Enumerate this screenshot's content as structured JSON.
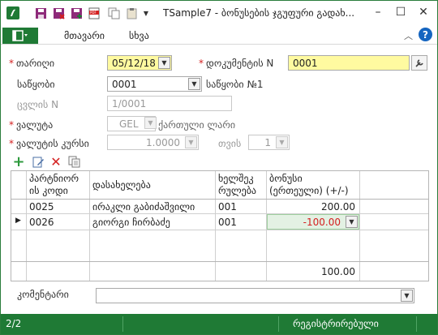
{
  "titlebar": {
    "title": "TSample7 - ბონუსების ჯგუფური გადახ..."
  },
  "tabs": [
    "მთავარი",
    "სხვა"
  ],
  "form": {
    "date_label": "თარიღი",
    "date_value": "05/12/18",
    "doc_label": "დოკუმენტის N",
    "doc_value": "0001",
    "warehouse_label": "საწყობი",
    "warehouse_value": "0001",
    "warehouse_name": "საწყობი №1",
    "change_label": "ცვლის N",
    "change_value": "1/0001",
    "currency_label": "ვალუტა",
    "currency_value": "GEL",
    "currency_name": "ქართული ლარი",
    "rate_label": "ვალუტის კურსი",
    "rate_value": "1.0000",
    "for_label": "თვის",
    "for_value": "1",
    "comment_label": "კომენტარი",
    "comment_value": ""
  },
  "grid": {
    "headers": [
      "პარტნიორის კოდი",
      "დასახელება",
      "ხელშეკრულება",
      "ბონუსი (ერთეული) (+/-)"
    ],
    "header_lines": [
      [
        "პარტნიორ",
        "ის კოდი"
      ],
      [
        "დასახელება"
      ],
      [
        "ხელშეკ",
        "რულება"
      ],
      [
        "ბონუსი",
        "(ერთეული) (+/-)"
      ]
    ],
    "rows": [
      {
        "code": "0025",
        "name": "ირაკლი გაბიძაშვილი",
        "contract": "001",
        "bonus": "200.00"
      },
      {
        "code": "0026",
        "name": "გიორგი ჩირბაძე",
        "contract": "001",
        "bonus": "-100.00"
      }
    ],
    "total": "100.00"
  },
  "status": {
    "page": "2/2",
    "state": "რეგისტრირებული"
  },
  "colors": {
    "brand_green": "#1f7a35",
    "required_red": "#d42020",
    "highlight_yellow": "#fffaa0",
    "negative_red": "#d42020",
    "edit_cell_green": "#e3f1e3"
  }
}
